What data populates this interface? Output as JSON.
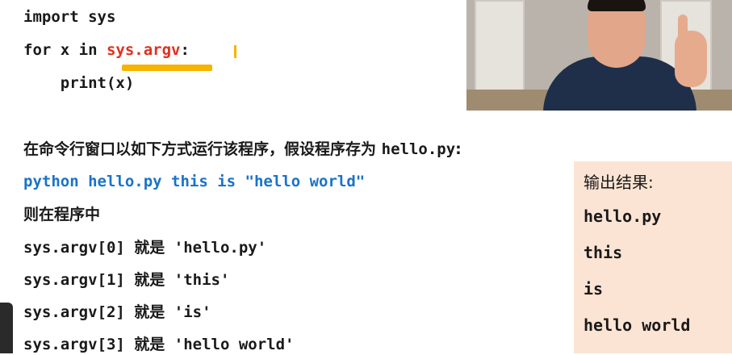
{
  "code": {
    "line1": "import sys",
    "line2_prefix": "for x in ",
    "line2_argv": "sys.argv",
    "line2_suffix": ":",
    "line3": "    print(x)"
  },
  "prose": {
    "run_intro": "在命令行窗口以如下方式运行该程序，假设程序存为 ",
    "filename": "hello.py",
    "run_intro_end": ":",
    "command": "python hello.py this is \"hello world\"",
    "in_program": "则在程序中"
  },
  "argv": [
    {
      "expr": "sys.argv[0]",
      "is": "就是",
      "value": "'hello.py'"
    },
    {
      "expr": "sys.argv[1]",
      "is": "就是",
      "value": "'this'"
    },
    {
      "expr": "sys.argv[2]",
      "is": "就是",
      "value": "'is'"
    },
    {
      "expr": "sys.argv[3]",
      "is": "就是",
      "value": "'hello world'"
    }
  ],
  "output": {
    "title": "输出结果:",
    "lines": [
      "hello.py",
      "this",
      "is",
      "hello world"
    ]
  },
  "colors": {
    "accent_red": "#e0301e",
    "accent_blue": "#1a73c8",
    "highlight": "#f5b400",
    "output_bg": "#fce4d4"
  }
}
